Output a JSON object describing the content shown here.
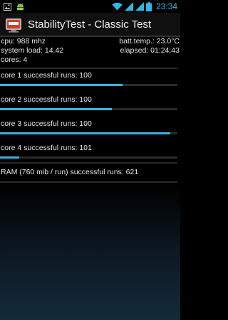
{
  "status_bar": {
    "time": "23:34"
  },
  "app": {
    "title": "StabilityTest - Classic Test"
  },
  "info": {
    "cpu": "cpu: 988 mhz",
    "batt_temp": "batt.temp.: 23.0°C",
    "system_load": "system load: 14.42",
    "elapsed": "elapsed: 01:24:43",
    "cores": "cores: 4"
  },
  "cores": [
    {
      "label": "core 1 successful runs: 100",
      "progress": 0.69
    },
    {
      "label": "core 2 successful runs: 100",
      "progress": 0.63
    },
    {
      "label": "core 3 successful runs: 100",
      "progress": 0.96
    },
    {
      "label": "core 4 successful runs: 101",
      "progress": 0.11
    }
  ],
  "ram": {
    "label": "RAM (760 mib / run) successful runs: 621"
  },
  "colors": {
    "accent": "#33b5e5",
    "android_green": "#8fd14f"
  }
}
